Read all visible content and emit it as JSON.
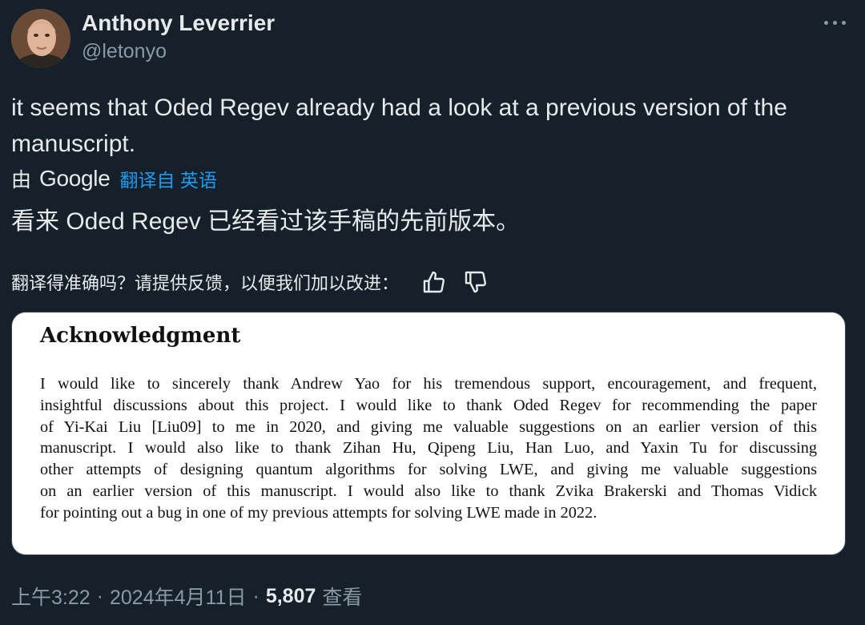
{
  "author": {
    "name": "Anthony Leverrier",
    "handle": "@letonyo"
  },
  "tweet": {
    "text": "it seems that Oded Regev already had a look at a previous version of the manuscript.",
    "translation": {
      "by_prefix": "由",
      "provider": "Google",
      "link_label": "翻译自 英语",
      "text": "看来 Oded Regev 已经看过该手稿的先前版本。"
    },
    "feedback_prompt": "翻译得准确吗？请提供反馈，以便我们加以改进："
  },
  "media": {
    "heading": "Acknowledgment",
    "lines": [
      "I would like to sincerely thank Andrew Yao for his tremendous support, encouragement, and frequent,",
      "insightful discussions about this project. I would like to thank Oded Regev for recommending the paper",
      "of Yi-Kai Liu [Liu09] to me in 2020, and giving me valuable suggestions on an earlier version of this",
      "manuscript. I would also like to thank Zihan Hu, Qipeng Liu, Han Luo, and Yaxin Tu for discussing",
      "other attempts of designing quantum algorithms for solving LWE, and giving me valuable suggestions",
      "on an earlier version of this manuscript. I would also like to thank Zvika Brakerski and Thomas Vidick",
      "for pointing out a bug in one of my previous attempts for solving LWE made in 2022."
    ]
  },
  "meta": {
    "time": "上午3:22",
    "separator": "·",
    "date": "2024年4月11日",
    "views_count": "5,807",
    "views_label": "查看"
  },
  "icons": {
    "more": "more-horizontal-icon",
    "like": "thumbs-up-icon",
    "dislike": "thumbs-down-icon"
  },
  "colors": {
    "background": "#15202b",
    "text": "#e7e9ea",
    "secondary": "#8b98a5",
    "link": "#1d9bf0"
  }
}
